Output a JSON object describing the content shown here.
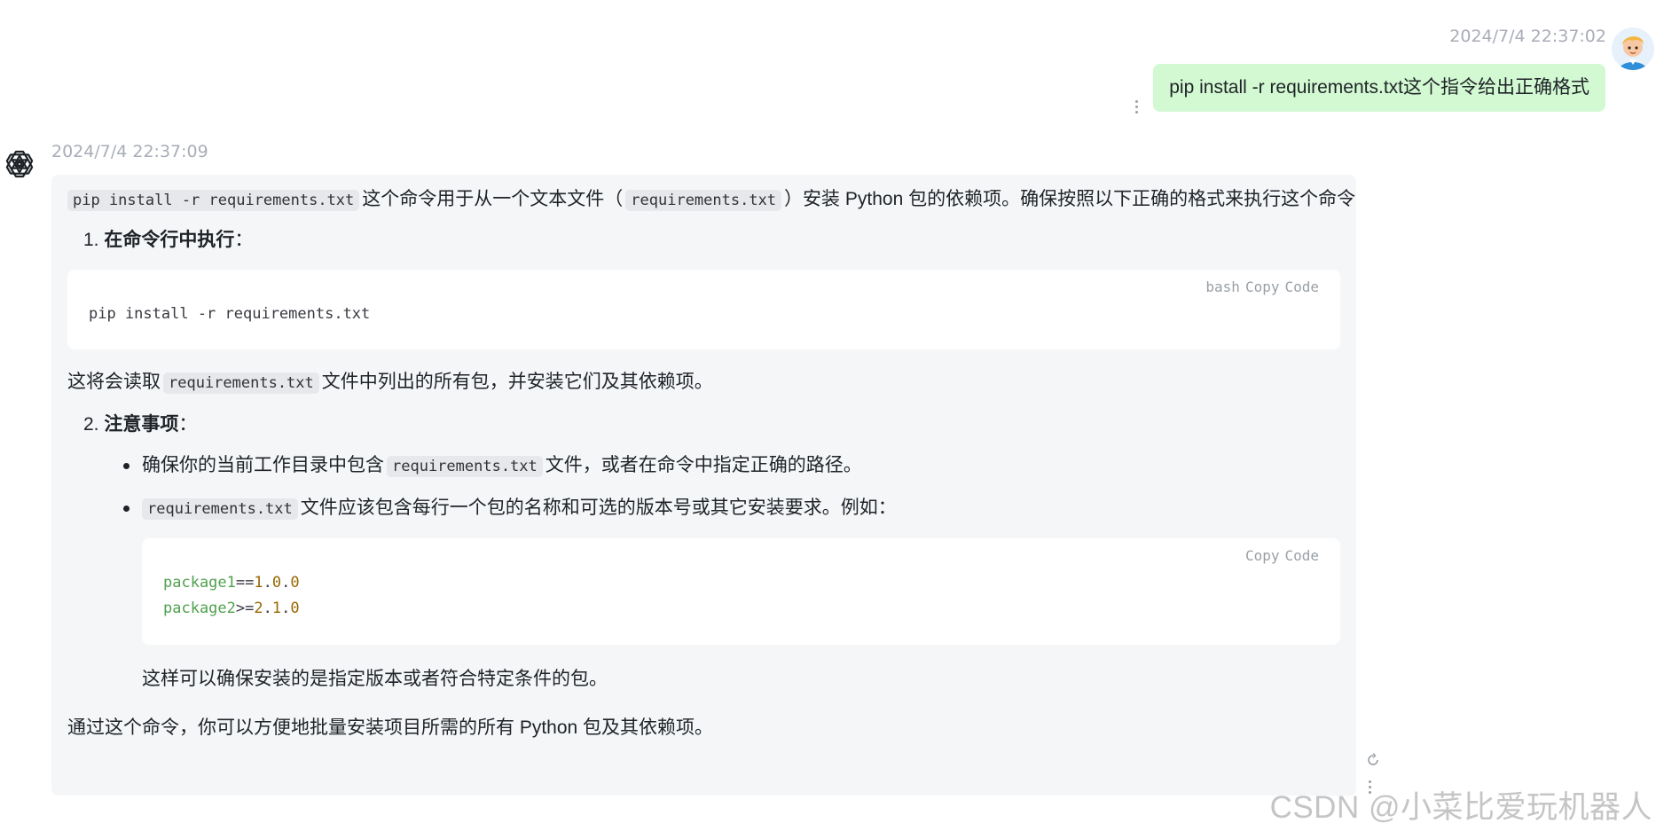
{
  "user_message": {
    "timestamp": "2024/7/4 22:37:02",
    "text": "pip install -r requirements.txt这个指令给出正确格式"
  },
  "assistant_message": {
    "timestamp": "2024/7/4 22:37:09",
    "intro": {
      "code1": "pip install -r requirements.txt",
      "text1": "这个命令用于从一个文本文件（",
      "code2": "requirements.txt",
      "text2": "）安装 Python 包的依赖项。确保按照以下正确的格式来执行这个命令："
    },
    "step1": {
      "number": "1.",
      "title": "在命令行中执行",
      "suffix": "："
    },
    "code_block_1": {
      "language": "bash",
      "copy_label": "Copy",
      "code_label": "Code",
      "line": "pip install -r requirements.txt"
    },
    "after_code_1": {
      "text1": "这将会读取",
      "code": "requirements.txt",
      "text2": "文件中列出的所有包，并安装它们及其依赖项。"
    },
    "step2": {
      "number": "2.",
      "title": "注意事项",
      "suffix": "："
    },
    "bullet1": {
      "text1": "确保你的当前工作目录中包含",
      "code": "requirements.txt",
      "text2": "文件，或者在命令中指定正确的路径。"
    },
    "bullet2": {
      "code": "requirements.txt",
      "text": "文件应该包含每行一个包的名称和可选的版本号或其它安装要求。例如："
    },
    "code_block_2": {
      "copy_label": "Copy",
      "code_label": "Code",
      "lines": [
        {
          "name": "package1",
          "op": "==",
          "v1": "1",
          "d1": ".",
          "v2": "0",
          "d2": ".",
          "v3": "0"
        },
        {
          "name": "package2",
          "op": ">=",
          "v1": "2",
          "d1": ".",
          "v2": "1",
          "d2": ".",
          "v3": "0"
        }
      ]
    },
    "after_code_2": "这样可以确保安装的是指定版本或者符合特定条件的包。",
    "conclusion": "通过这个命令，你可以方便地批量安装项目所需的所有 Python 包及其依赖项。"
  },
  "watermark": "CSDN @小菜比爱玩机器人",
  "icons": {
    "user_avatar": "cartoon-avatar-icon",
    "assistant_avatar": "openai-logo-icon",
    "more": "kebab-menu-icon",
    "regenerate": "refresh-icon"
  },
  "colors": {
    "user_bubble": "#d2f9d1",
    "assistant_bubble": "#f4f6f8",
    "timestamp": "#a8adb7",
    "code_name": "#50a14f",
    "code_number": "#986801"
  }
}
